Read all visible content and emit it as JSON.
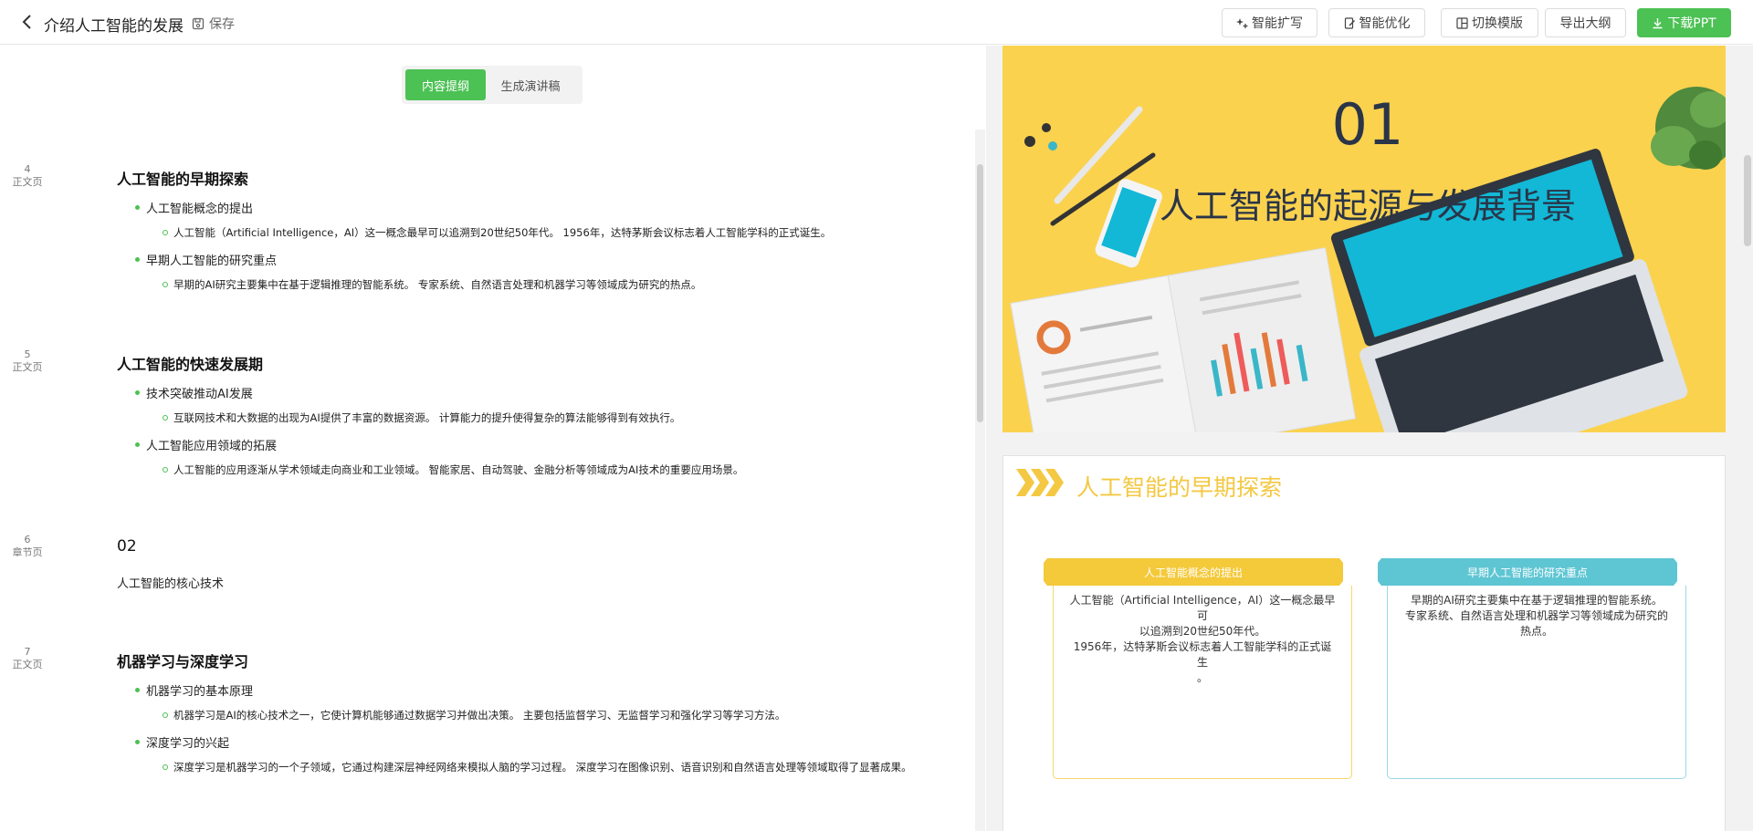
{
  "header": {
    "title": "介绍人工智能的发展",
    "save_label": "保存",
    "buttons": {
      "expand": "智能扩写",
      "optimize": "智能优化",
      "switch_template": "切换模版",
      "export_outline": "导出大纲",
      "download": "下载PPT"
    }
  },
  "tabs": {
    "outline": "内容提纲",
    "speech": "生成演讲稿"
  },
  "outline": [
    {
      "page": "4",
      "type": "正文页",
      "title": "人工智能的早期探索",
      "items": [
        {
          "heading": "人工智能概念的提出",
          "detail": "人工智能（Artificial Intelligence，AI）这一概念最早可以追溯到20世纪50年代。 1956年，达特茅斯会议标志着人工智能学科的正式诞生。"
        },
        {
          "heading": "早期人工智能的研究重点",
          "detail": "早期的AI研究主要集中在基于逻辑推理的智能系统。 专家系统、自然语言处理和机器学习等领域成为研究的热点。"
        }
      ]
    },
    {
      "page": "5",
      "type": "正文页",
      "title": "人工智能的快速发展期",
      "items": [
        {
          "heading": "技术突破推动AI发展",
          "detail": "互联网技术和大数据的出现为AI提供了丰富的数据资源。 计算能力的提升使得复杂的算法能够得到有效执行。"
        },
        {
          "heading": "人工智能应用领域的拓展",
          "detail": "人工智能的应用逐渐从学术领域走向商业和工业领域。 智能家居、自动驾驶、金融分析等领域成为AI技术的重要应用场景。"
        }
      ]
    },
    {
      "page": "6",
      "type": "章节页",
      "number": "02",
      "subtitle": "人工智能的核心技术"
    },
    {
      "page": "7",
      "type": "正文页",
      "title": "机器学习与深度学习",
      "items": [
        {
          "heading": "机器学习的基本原理",
          "detail": "机器学习是AI的核心技术之一，它使计算机能够通过数据学习并做出决策。 主要包括监督学习、无监督学习和强化学习等学习方法。"
        },
        {
          "heading": "深度学习的兴起",
          "detail": "深度学习是机器学习的一个子领域，它通过构建深层神经网络来模拟人脑的学习过程。 深度学习在图像识别、语音识别和自然语言处理等领域取得了显著成果。"
        }
      ]
    }
  ],
  "preview": {
    "slide1": {
      "number": "01",
      "title": "人工智能的起源与发展背景"
    },
    "slide2": {
      "title": "人工智能的早期探索",
      "cards": [
        {
          "title": "人工智能概念的提出",
          "lines": [
            "人工智能（Artificial Intelligence，AI）这一概念最早可",
            "以追溯到20世纪50年代。",
            "1956年，达特茅斯会议标志着人工智能学科的正式诞生",
            "。"
          ]
        },
        {
          "title": "早期人工智能的研究重点",
          "lines": [
            "早期的AI研究主要集中在基于逻辑推理的智能系统。",
            "专家系统、自然语言处理和机器学习等领域成为研究的",
            "热点。"
          ]
        }
      ]
    }
  },
  "colors": {
    "primary": "#4cc154",
    "slide_yellow": "#fbd24e",
    "title_yellow": "#f4c842",
    "card_yellow": "#f4c93a",
    "card_teal": "#5ec5d3",
    "dark_text": "#2a3548"
  },
  "icons": {
    "back": "chevron-left-icon",
    "save": "save-icon",
    "expand": "sparkle-plus-icon",
    "optimize": "edit-doc-icon",
    "switch": "layout-icon",
    "download": "download-icon"
  }
}
